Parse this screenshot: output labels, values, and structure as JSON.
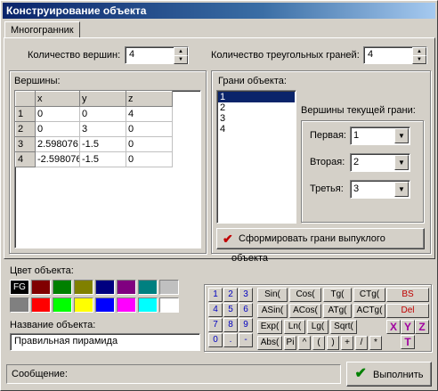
{
  "window": {
    "title": "Конструирование объекта"
  },
  "tabs": [
    {
      "label": "Многогранник"
    }
  ],
  "vertex_count": {
    "label": "Количество вершин:",
    "value": "4"
  },
  "face_count": {
    "label": "Количество треугольных граней:",
    "value": "4"
  },
  "vertices": {
    "label": "Вершины:",
    "headers": [
      "",
      "x",
      "y",
      "z"
    ],
    "rows": [
      [
        "1",
        "0",
        "0",
        "4"
      ],
      [
        "2",
        "0",
        "3",
        "0"
      ],
      [
        "3",
        "2.598076",
        "-1.5",
        "0"
      ],
      [
        "4",
        "-2.598076",
        "-1.5",
        "0"
      ]
    ]
  },
  "faces": {
    "label": "Грани объекта:",
    "items": [
      "1",
      "2",
      "3",
      "4"
    ],
    "selected": "1"
  },
  "current_face": {
    "label": "Вершины текущей грани:",
    "first_label": "Первая:",
    "first_value": "1",
    "second_label": "Вторая:",
    "second_value": "2",
    "third_label": "Третья:",
    "third_value": "3"
  },
  "build_button": {
    "label": "Сформировать грани выпуклого объекта",
    "icon": "checkmark-icon"
  },
  "color": {
    "label": "Цвет объекта:",
    "fg_label": "FG",
    "palette_row1": [
      "#000000",
      "#800000",
      "#008000",
      "#808000",
      "#000080",
      "#800080",
      "#008080",
      "#c0c0c0"
    ],
    "palette_row2": [
      "#808080",
      "#ff0000",
      "#00ff00",
      "#ffff00",
      "#0000ff",
      "#ff00ff",
      "#00ffff",
      "#ffffff"
    ]
  },
  "object_name": {
    "label": "Название объекта:",
    "value": "Правильная пирамида"
  },
  "keypad": {
    "digits": [
      "1",
      "2",
      "3",
      "4",
      "5",
      "6",
      "7",
      "8",
      "9",
      "0",
      ".",
      "-"
    ],
    "functions": [
      "Sin(",
      "Cos(",
      "Tg(",
      "CTg(",
      "ASin(",
      "ACos(",
      "ATg(",
      "ACTg(",
      "Exp(",
      "Ln(",
      "Lg(",
      "Sqrt(",
      "Abs(",
      "Pi",
      "^",
      "(",
      ")",
      "+",
      "/",
      "*"
    ],
    "bs": "BS",
    "del": "Del",
    "vars": [
      "X",
      "Y",
      "Z",
      "T"
    ]
  },
  "status": {
    "label": "Сообщение:"
  },
  "ok_button": {
    "label": "Выполнить",
    "icon": "checkmark-icon"
  }
}
